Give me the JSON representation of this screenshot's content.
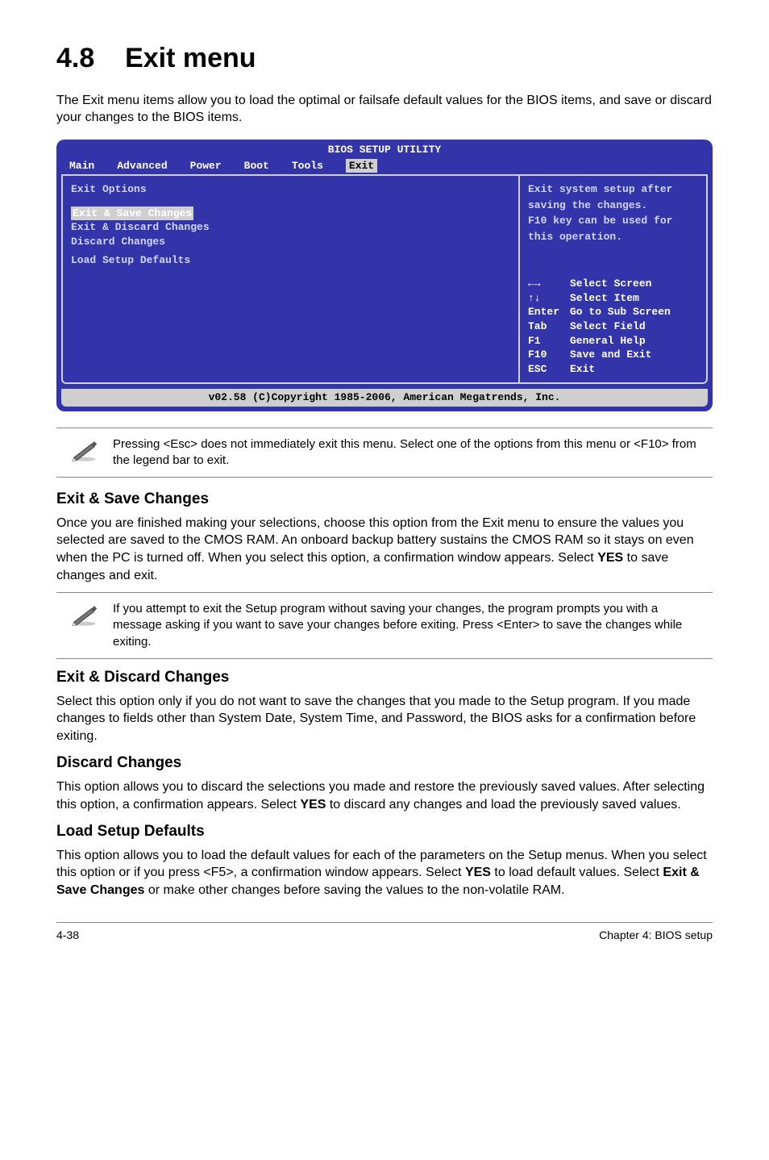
{
  "section": {
    "number": "4.8",
    "title": "Exit menu"
  },
  "intro": "The Exit menu items allow you to load the optimal or failsafe default values for the BIOS items, and save or discard your changes to the BIOS items.",
  "bios": {
    "util_title": "BIOS SETUP UTILITY",
    "tabs": [
      "Main",
      "Advanced",
      "Power",
      "Boot",
      "Tools",
      "Exit"
    ],
    "active_tab": "Exit",
    "left": {
      "heading": "Exit Options",
      "selected": "Exit & Save Changes",
      "items": [
        "Exit & Discard Changes",
        "Discard Changes",
        "Load Setup Defaults"
      ]
    },
    "right": {
      "help": [
        "Exit system setup after",
        "saving the changes.",
        "",
        "F10 key can be used for",
        "this operation."
      ],
      "keys": [
        {
          "k": "←→",
          "d": "Select Screen"
        },
        {
          "k": "↑↓",
          "d": "Select Item"
        },
        {
          "k": "Enter",
          "d": "Go to Sub Screen"
        },
        {
          "k": "Tab",
          "d": "Select Field"
        },
        {
          "k": "F1",
          "d": "General Help"
        },
        {
          "k": "F10",
          "d": "Save and Exit"
        },
        {
          "k": "ESC",
          "d": "Exit"
        }
      ]
    },
    "footer": "v02.58 (C)Copyright 1985-2006, American Megatrends, Inc."
  },
  "note1": "Pressing <Esc> does not immediately exit this menu. Select one of the options from this menu or <F10> from the legend bar to exit.",
  "sections": {
    "save": {
      "title": "Exit & Save Changes",
      "body_a": "Once you are finished making your selections, choose this option from the Exit menu to ensure the values you selected are saved to the CMOS RAM. An onboard backup battery sustains the CMOS RAM so it stays on even when the PC is turned off. When you select this option, a confirmation window appears. Select ",
      "yes": "YES",
      "body_b": " to save changes and exit."
    },
    "note2": "If you attempt to exit the Setup program without saving your changes, the program prompts you with a message asking if you want to save your changes before exiting. Press <Enter>  to save the  changes while exiting.",
    "discard_ex": {
      "title": "Exit & Discard Changes",
      "body": "Select this option only if you do not want to save the changes that you made to the Setup program. If you made changes to fields other than System Date, System Time, and Password, the BIOS asks for a confirmation before exiting."
    },
    "discard": {
      "title": "Discard Changes",
      "body_a": "This option allows you to discard the selections you made and restore the previously saved values. After selecting this option, a confirmation appears. Select ",
      "yes": "YES",
      "body_b": " to discard any changes and load the previously saved values."
    },
    "load": {
      "title": "Load Setup Defaults",
      "body_a": "This option allows you to load the default values for each of the parameters on the Setup menus. When you select this option or if you press <F5>, a confirmation window appears. Select ",
      "yes": "YES",
      "body_b": " to load default values. Select ",
      "exitsave": "Exit & Save Changes",
      "body_c": " or make other changes before saving the values to the non-volatile RAM."
    }
  },
  "footer": {
    "left": "4-38",
    "right": "Chapter 4: BIOS setup"
  }
}
